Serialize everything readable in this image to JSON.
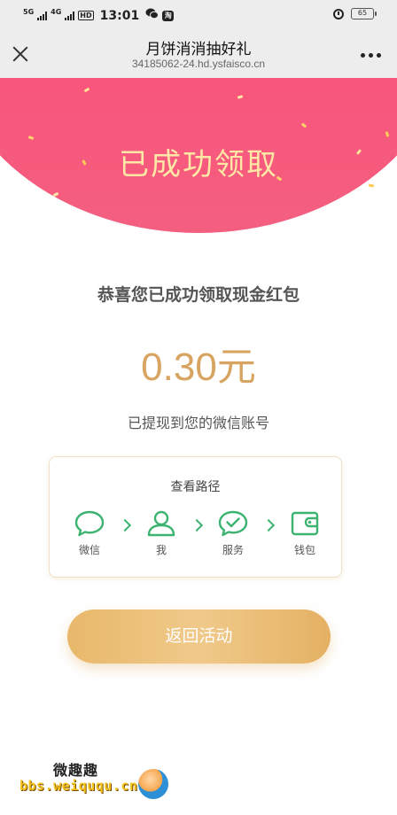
{
  "status_bar": {
    "network_1": "5G",
    "network_2": "4G",
    "hd_badge": "HD",
    "time": "13:01",
    "app_icon_1": "wechat-icon",
    "app_icon_2": "taobao-icon",
    "app_icon_2_text": "淘",
    "alarm_icon": "alarm-icon",
    "battery_level": "65"
  },
  "header": {
    "close_icon": "close-icon",
    "title": "月饼消消抽好礼",
    "url": "34185062-24.hd.ysfaisco.cn",
    "more_icon": "more-icon"
  },
  "banner": {
    "title": "已成功领取"
  },
  "result": {
    "congrats": "恭喜您已成功领取现金红包",
    "amount_value": "0.30",
    "amount_unit": "元",
    "note": "已提现到您的微信账号"
  },
  "path_card": {
    "title": "查看路径",
    "steps": [
      {
        "icon": "chat-bubble-icon",
        "label": "微信"
      },
      {
        "icon": "user-icon",
        "label": "我"
      },
      {
        "icon": "checkmark-bubble-icon",
        "label": "服务"
      },
      {
        "icon": "wallet-icon",
        "label": "钱包"
      }
    ]
  },
  "actions": {
    "return_label": "返回活动"
  },
  "watermark": {
    "site_name": "微趣趣",
    "url": "bbs.weiququ.cn"
  },
  "colors": {
    "banner": "#f8557c",
    "banner_title": "#ffe7a6",
    "amount": "#d8a461",
    "path_green": "#3cb371",
    "button": "#ebbd76"
  }
}
